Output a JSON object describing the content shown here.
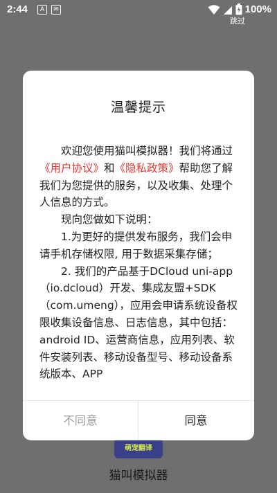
{
  "status_bar": {
    "time": "2:44",
    "notification_icons": [
      "A",
      "✉"
    ],
    "battery_percent": "100%",
    "icons": [
      "wifi-icon",
      "signal-icon",
      "battery-icon"
    ]
  },
  "skip_label": "跳过",
  "background": {
    "logo_text": "萌宠翻译",
    "app_name": "猫叫模拟器"
  },
  "dialog": {
    "title": "温馨提示",
    "paragraphs": {
      "p1_pre": "欢迎您使用猫叫模拟器！我们将通过",
      "link_user": "《用户协议》",
      "p1_and": "和",
      "link_privacy": "《隐私政策》",
      "p1_post": "帮助您了解我们为您提供的服务，以及收集、处理个人信息的方式。",
      "p2": "现向您做如下说明：",
      "p3": "1.为更好的提供发布服务，我们会申请手机存储权限, 用于数据采集存储；",
      "p4": "2. 我们的产品基于DCloud uni-app（io.dcloud）开发、集成友盟+SDK（com.umeng），应用会申请系统设备权限收集设备信息、日志信息，其中包括：android ID、运营商信息，应用列表、软件安装列表、移动设备型号、移动设备系统版本、APP"
    },
    "buttons": {
      "disagree": "不同意",
      "agree": "同意"
    }
  },
  "colors": {
    "link": "#e8342f",
    "dim_background": "#6f6f6f",
    "dialog_bg": "#ffffff"
  }
}
